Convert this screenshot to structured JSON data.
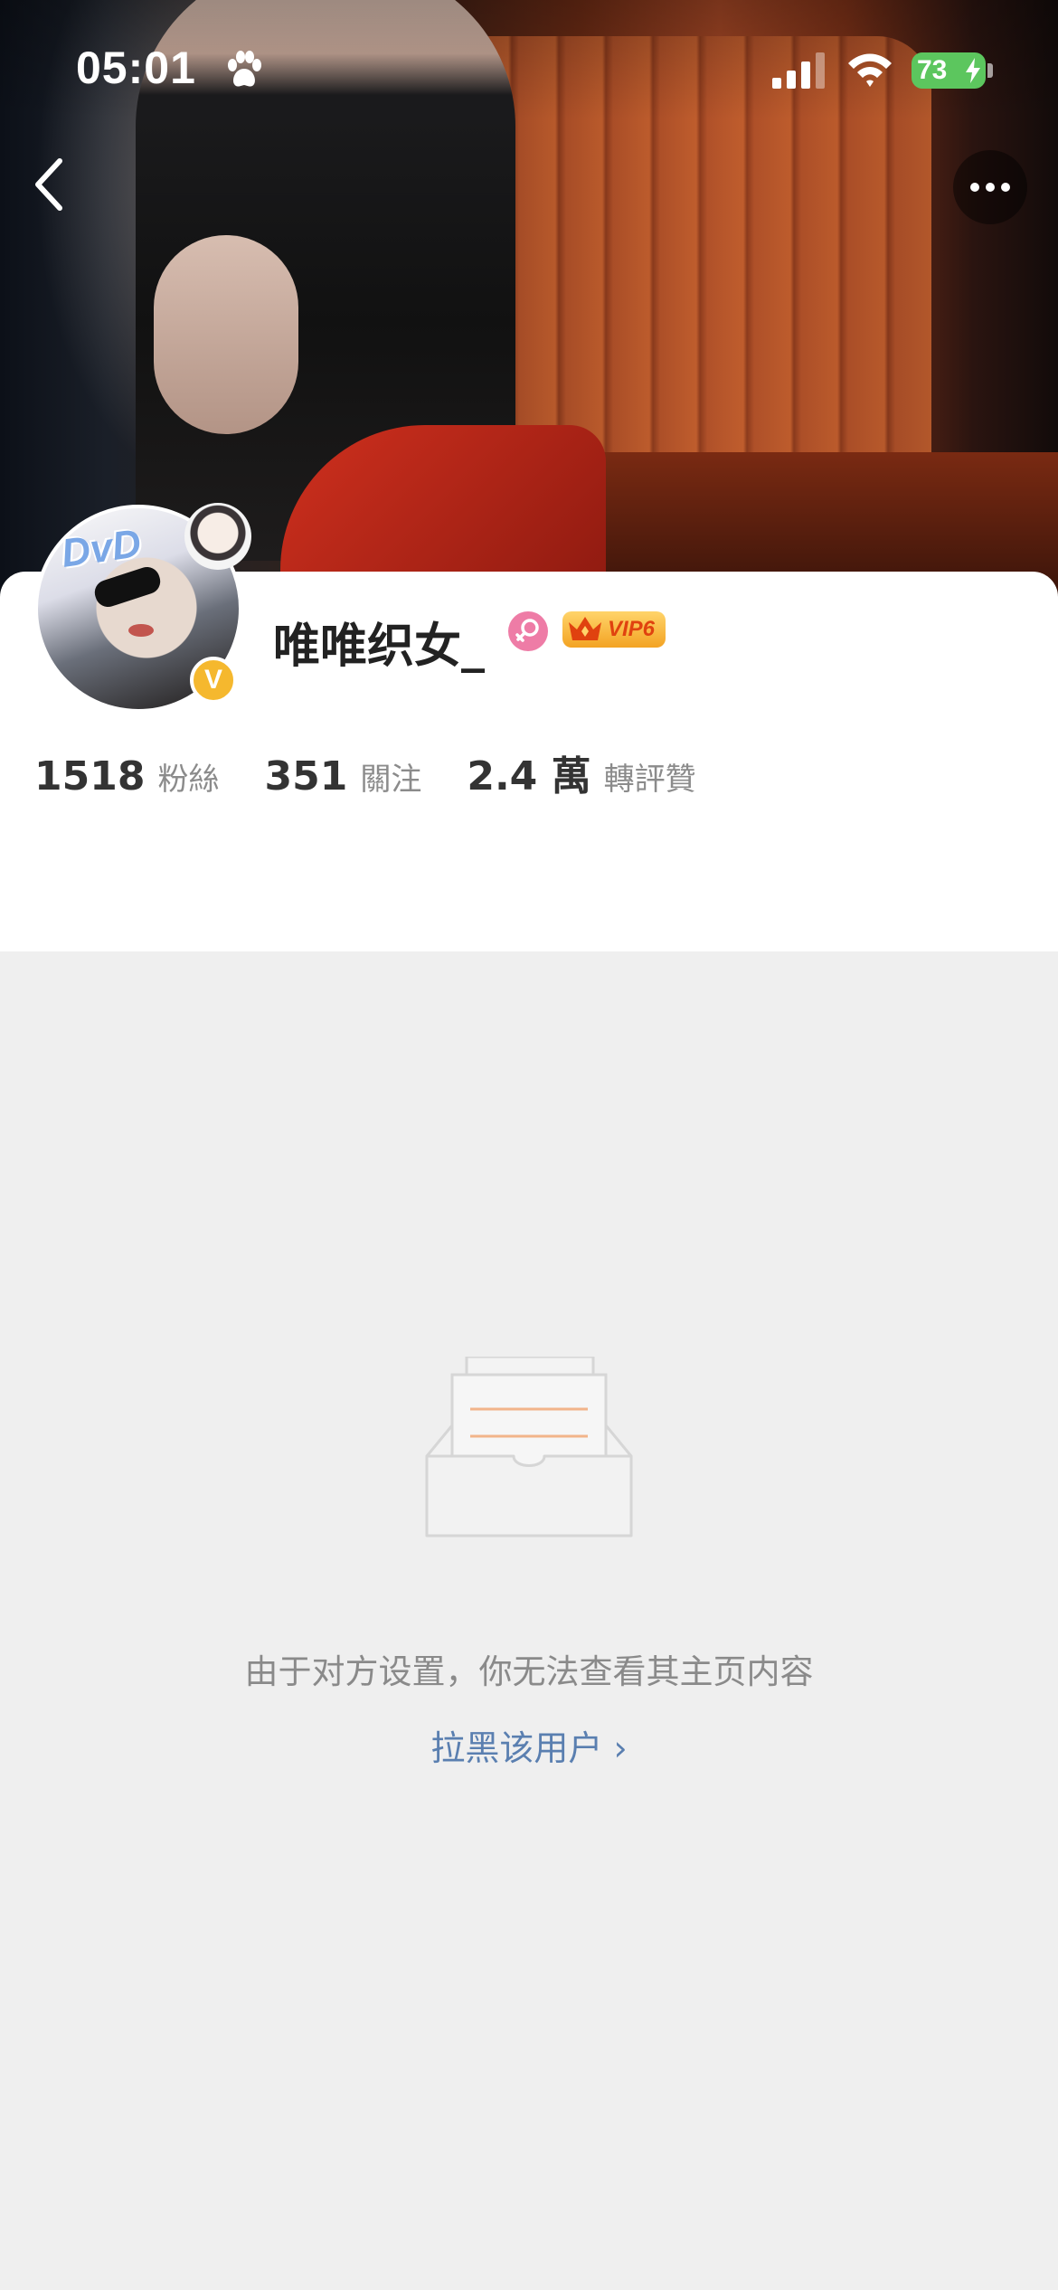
{
  "status_bar": {
    "time": "05:01",
    "battery_level": "73",
    "icons": [
      "paw-icon",
      "signal-icon",
      "wifi-icon",
      "battery-icon"
    ]
  },
  "nav": {
    "back_icon": "chevron-left-icon",
    "more_icon": "more-dots-icon"
  },
  "profile": {
    "username": "唯唯织女_",
    "avatar_text": "DvD",
    "verified_badge": "V",
    "gender": "female",
    "vip_label": "VIP6",
    "stats": [
      {
        "value": "1518",
        "label": "粉絲"
      },
      {
        "value": "351",
        "label": "關注"
      },
      {
        "value": "2.4 萬",
        "label": "轉評贊"
      }
    ]
  },
  "empty_state": {
    "message": "由于对方设置，你无法查看其主页内容",
    "block_link": "拉黑该用户 ›"
  },
  "colors": {
    "link": "#5a7fb0",
    "badge_verified": "#f5b82e",
    "gender_female": "#ee7ca6",
    "battery": "#5cc65e",
    "background": "#efefef"
  }
}
